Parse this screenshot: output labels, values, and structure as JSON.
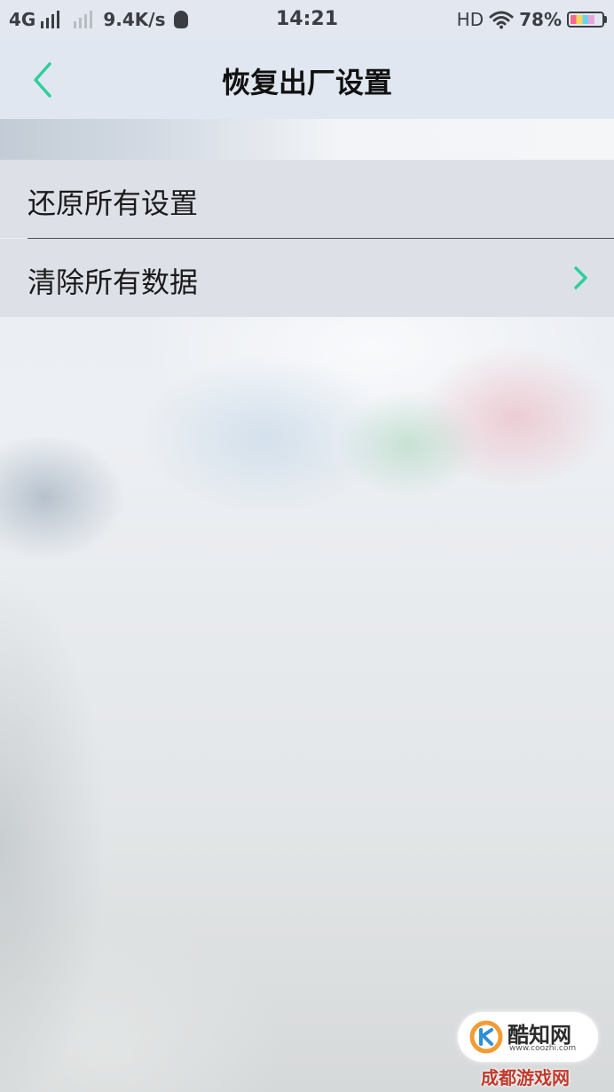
{
  "status_bar": {
    "network": "4G",
    "speed": "9.4K/s",
    "time": "14:21",
    "hd": "HD",
    "battery": "78%",
    "battery_level": 0.78
  },
  "header": {
    "title": "恢复出厂设置",
    "back_icon": "chevron-left-icon"
  },
  "menu": {
    "items": [
      {
        "label": "还原所有设置",
        "has_arrow": false
      },
      {
        "label": "清除所有数据",
        "has_arrow": true
      }
    ]
  },
  "watermark": {
    "name": "酷知网",
    "url": "www.coozhi.com",
    "bottom_text": "成都游戏网"
  },
  "colors": {
    "accent": "#2ecf9a",
    "status_text": "#3a3d42"
  }
}
